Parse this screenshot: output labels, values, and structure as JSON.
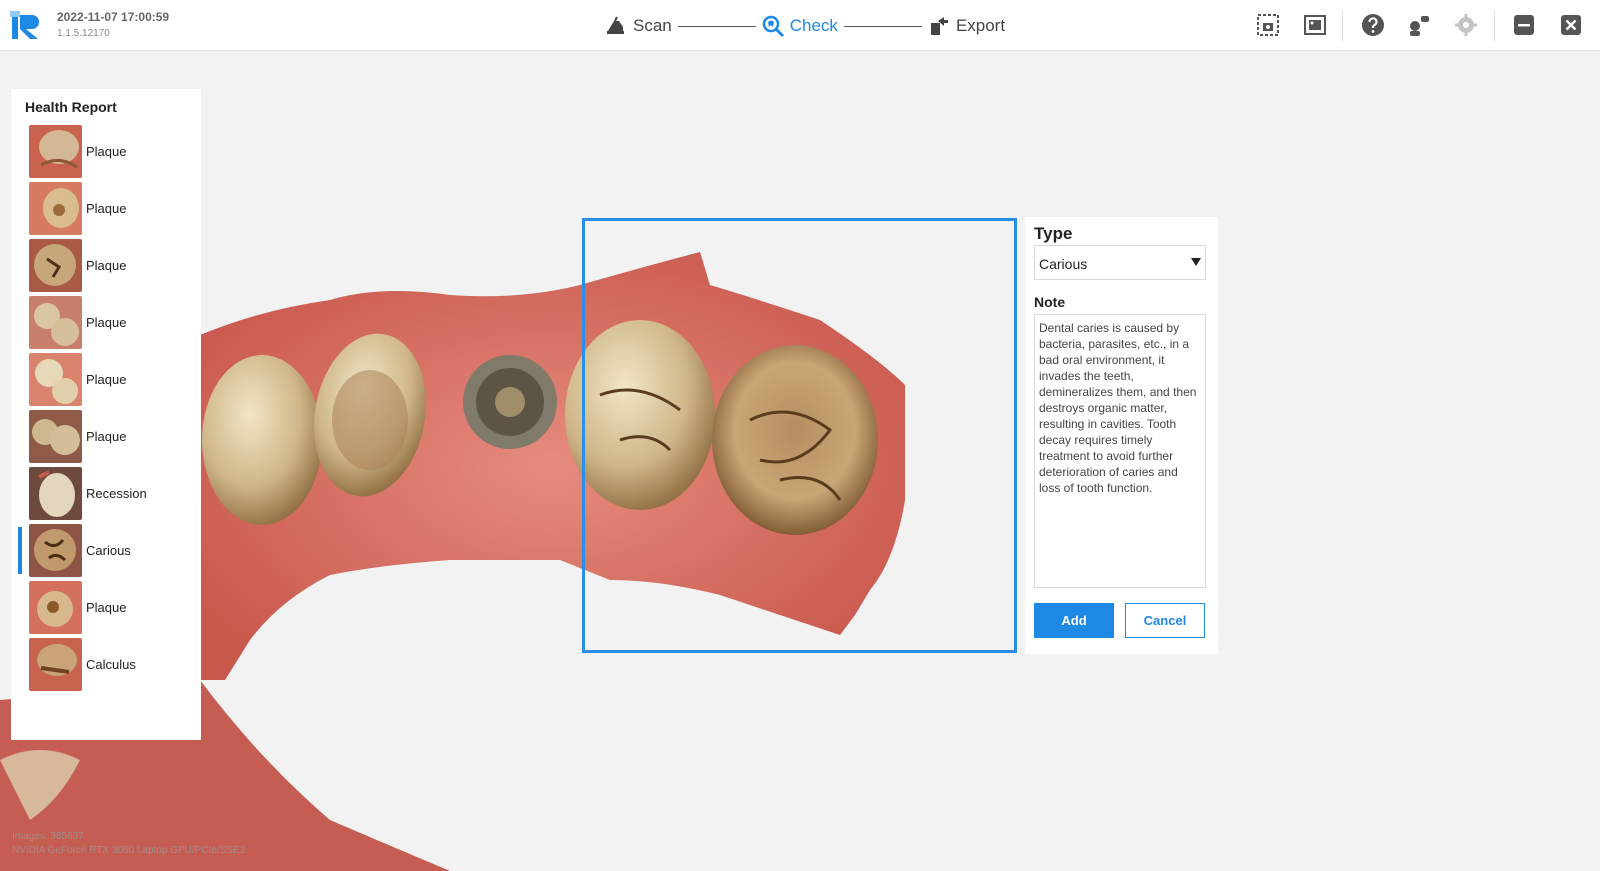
{
  "header": {
    "datetime": "2022-11-07 17:00:59",
    "version": "1.1.5.12170",
    "steps": [
      {
        "label": "Scan",
        "icon": "scanner-icon"
      },
      {
        "label": "Check",
        "icon": "magnify-tooth-icon",
        "active": true
      },
      {
        "label": "Export",
        "icon": "export-icon"
      }
    ],
    "tools": [
      "screenshot-icon",
      "gallery-icon",
      "help-icon",
      "connect-icon",
      "settings-icon",
      "minimize-icon",
      "close-icon"
    ],
    "accent": "#1e88e5"
  },
  "health_report": {
    "title": "Health Report",
    "items": [
      {
        "label": "Plaque"
      },
      {
        "label": "Plaque"
      },
      {
        "label": "Plaque"
      },
      {
        "label": "Plaque"
      },
      {
        "label": "Plaque"
      },
      {
        "label": "Plaque"
      },
      {
        "label": "Recession"
      },
      {
        "label": "Carious",
        "selected": true
      },
      {
        "label": "Plaque"
      },
      {
        "label": "Calculus"
      }
    ]
  },
  "editor": {
    "type_label": "Type",
    "type_value": "Carious",
    "note_label": "Note",
    "note_text": "Dental caries is caused by bacteria, parasites, etc., in a bad oral environment, it invades the teeth, demineralizes them, and then destroys organic matter, resulting in cavities. Tooth decay requires timely treatment to avoid further deterioration of caries and loss of tooth function.",
    "add_label": "Add",
    "cancel_label": "Cancel"
  },
  "footer": {
    "images": "Images: 385637",
    "gpu": "NVIDIA GeForce RTX 3060 Laptop GPU/PCIe/SSE2"
  }
}
